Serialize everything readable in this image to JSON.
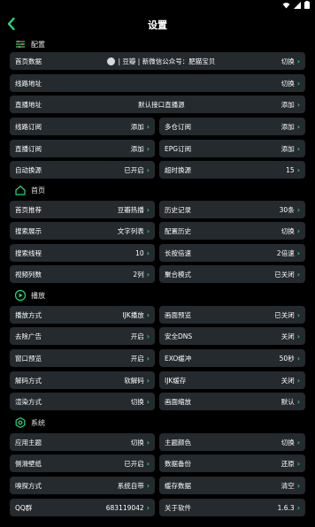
{
  "page": {
    "title": "设置"
  },
  "colors": {
    "accent": "#2bd67a",
    "row_bg": "#242a2e",
    "background": "#000000"
  },
  "sections": {
    "config": {
      "label": "配置",
      "icon": "sliders-icon"
    },
    "home": {
      "label": "首页",
      "icon": "home-icon"
    },
    "play": {
      "label": "播放",
      "icon": "play-icon"
    },
    "system": {
      "label": "系统",
      "icon": "settings-icon"
    }
  },
  "config": {
    "home_data": {
      "label": "首页数据",
      "mid": "| 豆瓣 | 新微信公众号：肥猫宝贝",
      "value": "切换"
    },
    "line_address": {
      "label": "线路地址",
      "value": "切换"
    },
    "live_address": {
      "label": "直播地址",
      "mid": "默认接口直播源",
      "value": "添加"
    },
    "line_sub": {
      "label": "线路订阅",
      "value": "添加"
    },
    "multi_repo_sub": {
      "label": "多仓订阅",
      "value": "添加"
    },
    "live_sub": {
      "label": "直播订阅",
      "value": "添加"
    },
    "epg_sub": {
      "label": "EPG订阅",
      "value": "添加"
    },
    "auto_switch": {
      "label": "自动换源",
      "value": "已开启"
    },
    "timeout_switch": {
      "label": "超时换源",
      "value": "15"
    }
  },
  "home": {
    "recommend": {
      "label": "首页推荐",
      "value": "豆瓣热播"
    },
    "history": {
      "label": "历史记录",
      "value": "30条"
    },
    "search_display": {
      "label": "搜索展示",
      "value": "文字列表"
    },
    "config_history": {
      "label": "配置历史",
      "value": "切换"
    },
    "search_threads": {
      "label": "搜索线程",
      "value": "10"
    },
    "long_press_speed": {
      "label": "长按倍速",
      "value": "2倍速"
    },
    "video_columns": {
      "label": "视频列数",
      "value": "2列"
    },
    "aggregate_mode": {
      "label": "聚合模式",
      "value": "已关闭"
    }
  },
  "play": {
    "play_mode": {
      "label": "播放方式",
      "value": "IJK播放"
    },
    "preview": {
      "label": "画面预览",
      "value": "已关闭"
    },
    "ad_remove": {
      "label": "去除广告",
      "value": "开启"
    },
    "secure_dns": {
      "label": "安全DNS",
      "value": "关闭"
    },
    "window_preview": {
      "label": "窗口预览",
      "value": "开启"
    },
    "exo_buffer": {
      "label": "EXO缓冲",
      "value": "50秒"
    },
    "decode_mode": {
      "label": "解码方式",
      "value": "软解码"
    },
    "ijk_cache": {
      "label": "IJK缓存",
      "value": "关闭"
    },
    "render_mode": {
      "label": "渲染方式",
      "value": "切换"
    },
    "screen_scale": {
      "label": "画面缩放",
      "value": "默认"
    }
  },
  "system": {
    "app_theme": {
      "label": "应用主题",
      "value": "切换"
    },
    "theme_color": {
      "label": "主题颜色",
      "value": "切换"
    },
    "side_wallpaper": {
      "label": "侧滑壁纸",
      "value": "已开启"
    },
    "data_backup": {
      "label": "数据备份",
      "value": "还原"
    },
    "sniff_mode": {
      "label": "嗅探方式",
      "value": "系统自带"
    },
    "cache_data": {
      "label": "缓存数据",
      "value": "清空"
    },
    "qq_group": {
      "label": "QQ群",
      "value": "683119042"
    },
    "about": {
      "label": "关于软件",
      "value": "1.6.3"
    }
  }
}
